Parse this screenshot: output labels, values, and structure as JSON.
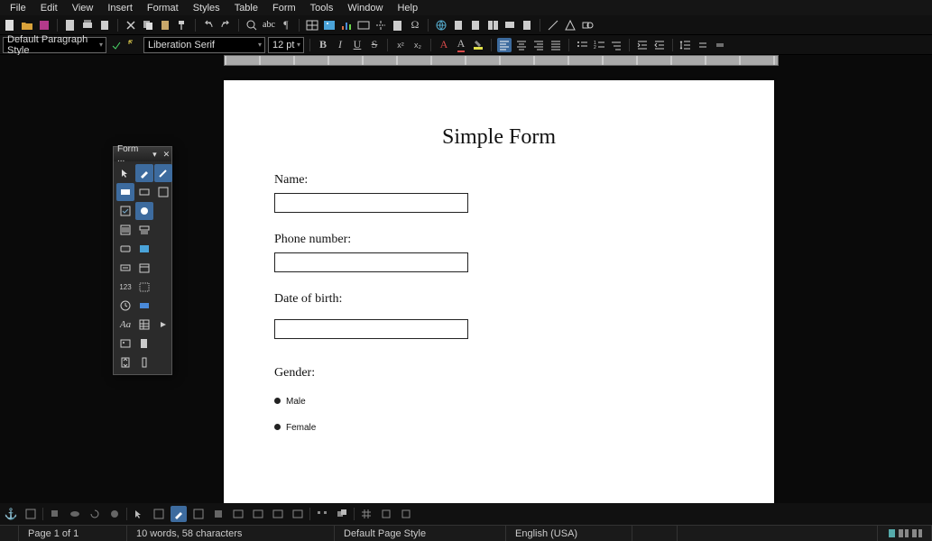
{
  "menu": [
    "File",
    "Edit",
    "View",
    "Insert",
    "Format",
    "Styles",
    "Table",
    "Form",
    "Tools",
    "Window",
    "Help"
  ],
  "style_combo": "Default Paragraph Style",
  "font_name": "Liberation Serif",
  "font_size": "12 pt",
  "form_panel_title": "Form ...",
  "document": {
    "title": "Simple Form",
    "label_name": "Name:",
    "label_phone": "Phone number:",
    "label_dob": "Date of birth:",
    "label_gender": "Gender:",
    "opt_male": "Male",
    "opt_female": "Female"
  },
  "status": {
    "page": "Page 1 of 1",
    "wordcount": "10 words, 58 characters",
    "pagestyle": "Default Page Style",
    "language": "English (USA)"
  }
}
